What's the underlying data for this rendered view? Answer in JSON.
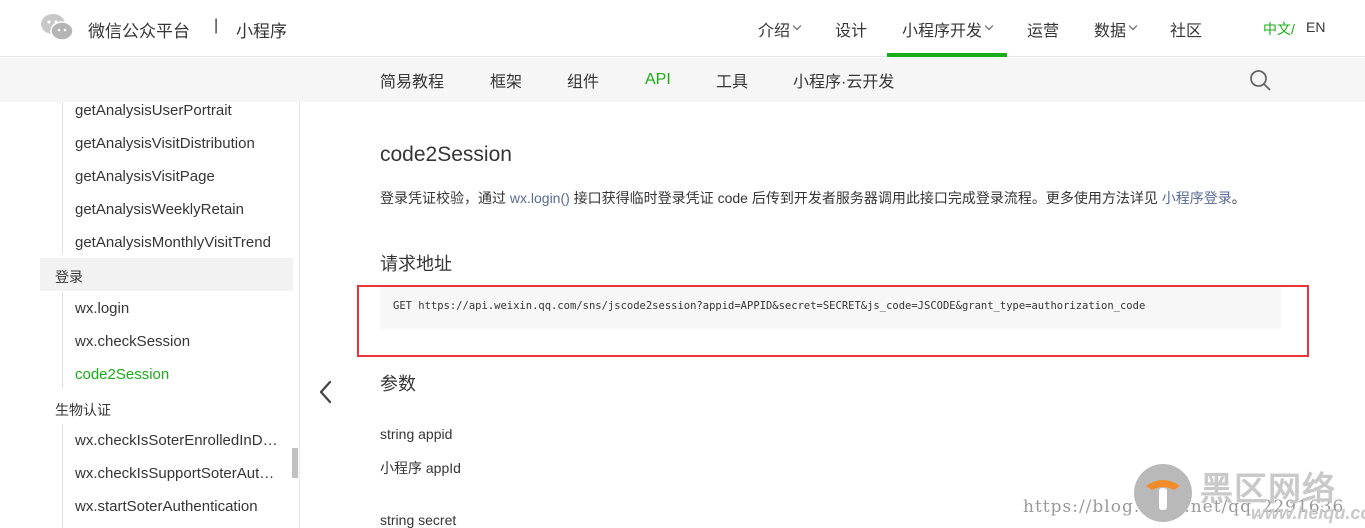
{
  "header": {
    "brand": "微信公众平台",
    "separator": "|",
    "sub_brand": "小程序",
    "nav": [
      {
        "label": "介绍"
      },
      {
        "label": "设计"
      },
      {
        "label": "小程序开发"
      },
      {
        "label": "运营"
      },
      {
        "label": "数据"
      },
      {
        "label": "社区"
      }
    ],
    "lang_zh": "中文/",
    "lang_en": "EN"
  },
  "subnav": [
    {
      "label": "简易教程"
    },
    {
      "label": "框架"
    },
    {
      "label": "组件"
    },
    {
      "label": "API"
    },
    {
      "label": "工具"
    },
    {
      "label": "小程序·云开发"
    }
  ],
  "sidebar": {
    "items_top": [
      "getAnalysisUserPortrait",
      "getAnalysisVisitDistribution",
      "getAnalysisVisitPage",
      "getAnalysisWeeklyRetain",
      "getAnalysisMonthlyVisitTrend"
    ],
    "group_login": "登录",
    "items_login": [
      "wx.login",
      "wx.checkSession",
      "code2Session"
    ],
    "group_bio": "生物认证",
    "items_bio": [
      "wx.checkIsSoterEnrolledInDevice",
      "wx.checkIsSupportSoterAuthentication",
      "wx.startSoterAuthentication"
    ]
  },
  "main": {
    "title": "code2Session",
    "desc_1": "登录凭证校验，通过 ",
    "desc_link1": "wx.login()",
    "desc_2": " 接口获得临时登录凭证 code 后传到开发者服务器调用此接口完成登录流程。更多使用方法详见 ",
    "desc_link2": "小程序登录",
    "desc_3": "。",
    "section_url": "请求地址",
    "code": "GET https://api.weixin.qq.com/sns/jscode2session?appid=APPID&secret=SECRET&js_code=JSCODE&grant_type=authorization_code",
    "section_params": "参数",
    "param1_name": "string appid",
    "param1_desc": "小程序 appId",
    "param2_name": "string secret"
  },
  "watermark": {
    "url_text": "https://blog.csdn.net/qq_2291636",
    "brand": "黑区网络",
    "sub": "www.heiqu.com"
  }
}
